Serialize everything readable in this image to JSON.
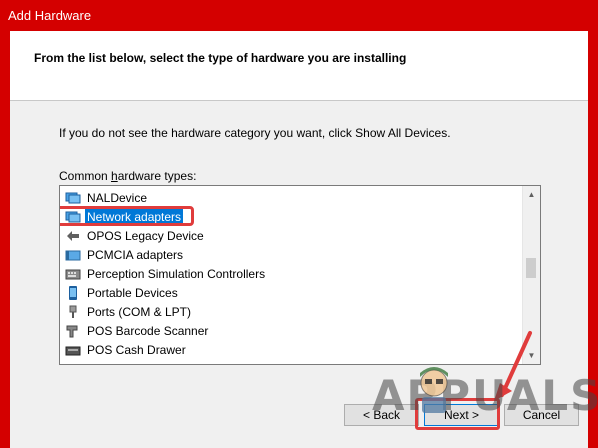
{
  "window": {
    "title": "Add Hardware"
  },
  "header": {
    "heading": "From the list below, select the type of hardware you are installing"
  },
  "content": {
    "instruction": "If you do not see the hardware category you want, click Show All Devices.",
    "list_label_before": "Common ",
    "list_label_accel": "h",
    "list_label_after": "ardware types:"
  },
  "list": {
    "items": [
      {
        "label": "NALDevice",
        "icon": "network-device-icon"
      },
      {
        "label": "Network adapters",
        "icon": "network-adapter-icon",
        "selected": true
      },
      {
        "label": "OPOS Legacy Device",
        "icon": "opos-device-icon"
      },
      {
        "label": "PCMCIA adapters",
        "icon": "pcmcia-card-icon"
      },
      {
        "label": "Perception Simulation Controllers",
        "icon": "simulation-controller-icon"
      },
      {
        "label": "Portable Devices",
        "icon": "portable-device-icon"
      },
      {
        "label": "Ports (COM & LPT)",
        "icon": "port-icon"
      },
      {
        "label": "POS Barcode Scanner",
        "icon": "barcode-scanner-icon"
      },
      {
        "label": "POS Cash Drawer",
        "icon": "cash-drawer-icon"
      }
    ]
  },
  "buttons": {
    "back": "< Back",
    "next": "Next >",
    "cancel": "Cancel"
  },
  "watermark": {
    "text": "APPUALS"
  },
  "colors": {
    "titlebar": "#d40000",
    "selection": "#0078d7",
    "annotation": "#e03c3c"
  }
}
